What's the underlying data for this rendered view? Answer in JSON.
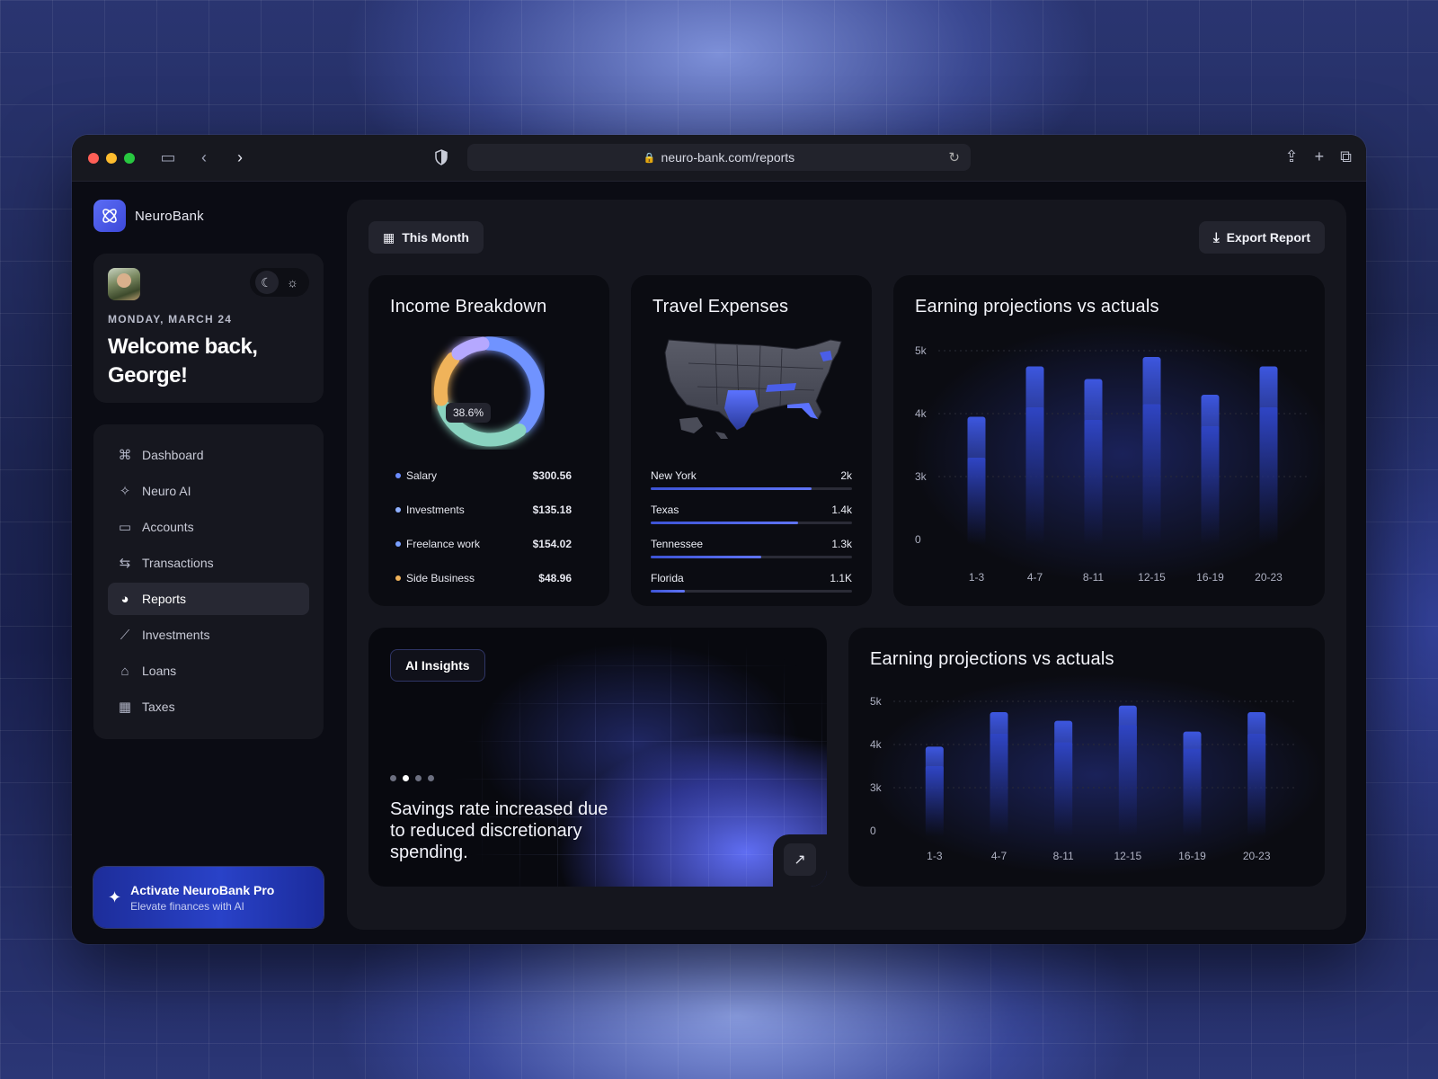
{
  "browser": {
    "url": "neuro-bank.com/reports"
  },
  "brand": {
    "name": "NeuroBank"
  },
  "welcome": {
    "date": "MONDAY, MARCH 24",
    "greeting": "Welcome back, George!"
  },
  "nav": {
    "items": [
      {
        "label": "Dashboard",
        "icon": "grid-icon",
        "active": false
      },
      {
        "label": "Neuro AI",
        "icon": "sparkle-icon",
        "active": false
      },
      {
        "label": "Accounts",
        "icon": "wallet-icon",
        "active": false
      },
      {
        "label": "Transactions",
        "icon": "transfer-icon",
        "active": false
      },
      {
        "label": "Reports",
        "icon": "pie-chart-icon",
        "active": true
      },
      {
        "label": "Investments",
        "icon": "trend-icon",
        "active": false
      },
      {
        "label": "Loans",
        "icon": "bank-icon",
        "active": false
      },
      {
        "label": "Taxes",
        "icon": "calculator-icon",
        "active": false
      }
    ]
  },
  "promo": {
    "title": "Activate NeuroBank Pro",
    "subtitle": "Elevate finances with AI"
  },
  "toolbar": {
    "period_label": "This Month",
    "export_label": "Export Report"
  },
  "income": {
    "title": "Income Breakdown",
    "center_badge": "38.6%",
    "items": [
      {
        "label": "Salary",
        "value": "$300.56",
        "color": "#6b8cff"
      },
      {
        "label": "Investments",
        "value": "$135.18",
        "color": "#8fb0ff"
      },
      {
        "label": "Freelance work",
        "value": "$154.02",
        "color": "#7aa0ff"
      },
      {
        "label": "Side Business",
        "value": "$48.96",
        "color": "#f0b35a"
      }
    ]
  },
  "travel": {
    "title": "Travel Expenses",
    "states": [
      {
        "name": "New York",
        "value": "2k",
        "fraction": 0.8
      },
      {
        "name": "Texas",
        "value": "1.4k",
        "fraction": 0.73
      },
      {
        "name": "Tennessee",
        "value": "1.3k",
        "fraction": 0.55
      },
      {
        "name": "Florida",
        "value": "1.1K",
        "fraction": 0.17
      }
    ]
  },
  "projections_top": {
    "title": "Earning projections vs actuals"
  },
  "insights": {
    "badge": "AI Insights",
    "text": "Savings rate increased due to reduced discretionary spending."
  },
  "projections_bottom": {
    "title": "Earning projections vs actuals"
  },
  "chart_data": [
    {
      "type": "bar",
      "title": "Earning projections vs actuals",
      "categories": [
        "1-3",
        "4-7",
        "8-11",
        "12-15",
        "16-19",
        "20-23"
      ],
      "y_ticks": [
        "5k",
        "4k",
        "3k",
        "0"
      ],
      "series": [
        {
          "values": [
            3.95,
            4.75,
            4.55,
            4.9,
            4.3,
            4.75
          ]
        },
        {
          "values": [
            3.3,
            4.1,
            3.9,
            4.15,
            3.8,
            4.1
          ]
        }
      ]
    },
    {
      "type": "bar",
      "title": "Earning projections vs actuals",
      "categories": [
        "1-3",
        "4-7",
        "8-11",
        "12-15",
        "16-19",
        "20-23"
      ],
      "y_ticks": [
        "5k",
        "4k",
        "3k",
        "0"
      ],
      "series": [
        {
          "values": [
            3.95,
            4.75,
            4.55,
            4.9,
            4.3,
            4.75
          ]
        },
        {
          "values": [
            3.5,
            4.25,
            4.05,
            4.45,
            3.9,
            4.25
          ]
        }
      ]
    }
  ],
  "colors": {
    "accent": "#4a5ff0",
    "bar_top": "#3a55d8",
    "window_bg": "#0b0c14"
  }
}
